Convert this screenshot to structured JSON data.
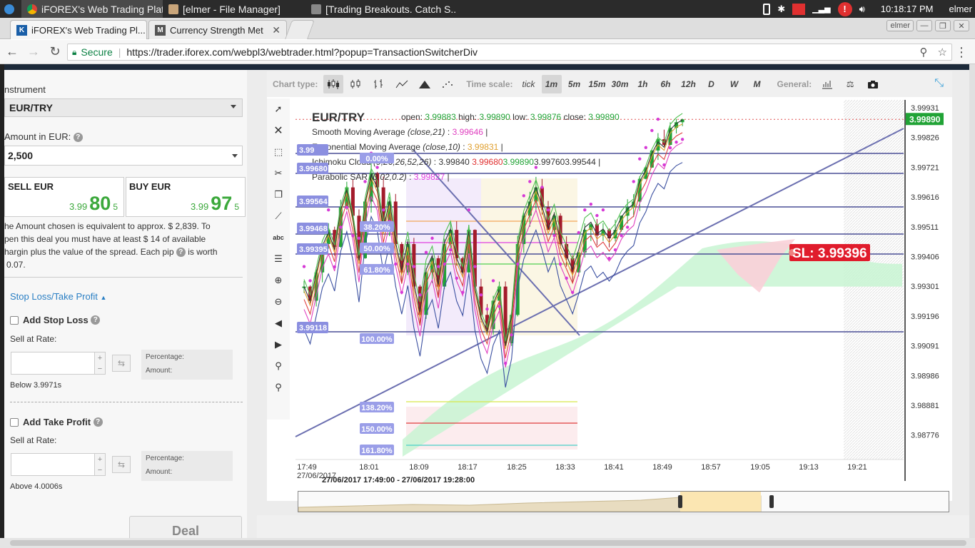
{
  "taskbar": {
    "tasks": [
      "iFOREX's Web Trading Platf...",
      "[elmer - File Manager]",
      "[Trading Breakouts. Catch S..."
    ],
    "time": "10:18:17 PM",
    "user": "elmer"
  },
  "browser": {
    "tabs": [
      "iFOREX's Web Trading Pl...",
      "Currency Strength Met"
    ],
    "user_badge": "elmer",
    "secure_label": "Secure",
    "url": "https://trader.iforex.com/webpl3/webtrader.html?popup=TransactionSwitcherDiv"
  },
  "panel": {
    "instrument_label": "nstrument",
    "instrument_value": "EUR/TRY",
    "amount_label": "Amount in EUR:",
    "amount_value": "2,500",
    "sell": {
      "label": "SELL EUR",
      "a": "3.99",
      "b": "80",
      "c": "5"
    },
    "buy": {
      "label": "BUY EUR",
      "a": "3.99",
      "b": "97",
      "c": "5"
    },
    "note_1": "he Amount chosen is equivalent to approx. $ 2,839. To",
    "note_2": "pen this deal you must have at least $ 14 of available",
    "note_3a": "hargin plus the value of the spread. Each pip",
    "note_3b": "is worth",
    "note_4": "0.07.",
    "sltp_title": "Stop Loss/Take Profit",
    "stop_loss": {
      "label": "Add Stop Loss",
      "rate_label": "Sell at Rate:",
      "pct_label": "Percentage:",
      "amt_label": "Amount:",
      "hint": "Below 3.9971s"
    },
    "take_profit": {
      "label": "Add Take Profit",
      "rate_label": "Sell at Rate:",
      "pct_label": "Percentage:",
      "amt_label": "Amount:",
      "hint": "Above 4.0006s"
    },
    "deal_label": "Deal"
  },
  "toolbar": {
    "chart_type_label": "Chart type:",
    "time_scale_label": "Time scale:",
    "general_label": "General:",
    "time_scales": [
      "tick",
      "1m",
      "5m",
      "15m",
      "30m",
      "1h",
      "6h",
      "12h",
      "D",
      "W",
      "M"
    ],
    "selected_time_scale": "1m"
  },
  "chart": {
    "symbol": "EUR/TRY",
    "ohlc": {
      "open_label": "open:",
      "open": "3.99883",
      "high_label": "high:",
      "high": "3.99890",
      "low_label": "low:",
      "low": "3.99876",
      "close_label": "close:",
      "close": "3.99890"
    },
    "indicators": {
      "sma": {
        "name": "Smooth Moving Average",
        "params": "(close,21)",
        "value": "3.99646"
      },
      "ema": {
        "name": "Exponential Moving Average",
        "params": "(close,10)",
        "value": "3.99831"
      },
      "ichimoku": {
        "name": "Ichimoku Cloud",
        "params": "(9,26,26,52,26)",
        "v1": "3.99840",
        "v2": "3.99680",
        "v3": "3.99890",
        "v4": "3.99760",
        "v5": "3.99544"
      },
      "psar": {
        "name": "Parabolic SAR",
        "params": "(0.02,0.2)",
        "value": "3.99827"
      }
    },
    "current_price": "3.99890",
    "sl_label": "SL: 3.99396",
    "range_label": "27/06/2017 17:49:00 - 27/06/2017 19:28:00",
    "date_label": "27/06/2017",
    "yticks": [
      "3.99931",
      "3.99826",
      "3.99721",
      "3.99616",
      "3.99511",
      "3.99406",
      "3.99301",
      "3.99196",
      "3.99091",
      "3.98986",
      "3.98881",
      "3.98776"
    ],
    "xticks": [
      "17:49",
      "18:01",
      "18:09",
      "18:17",
      "18:25",
      "18:33",
      "18:41",
      "18:49",
      "18:57",
      "19:05",
      "19:13",
      "19:21"
    ],
    "price_tags": [
      "3.99",
      "3.99680",
      "3.99564",
      "3.99468",
      "3.99395",
      "3.99118"
    ],
    "fib_levels": [
      "0.00%",
      "38.20%",
      "50.00%",
      "61.80%",
      "100.00%",
      "138.20%",
      "150.00%",
      "161.80%"
    ],
    "colors": {
      "up": "#21a336",
      "down": "#a31b2b",
      "sar": "#d63ad6",
      "cloud_green": "#c8f5d2",
      "cloud_red": "#fad0d8",
      "accent": "#3aa0d8"
    }
  }
}
